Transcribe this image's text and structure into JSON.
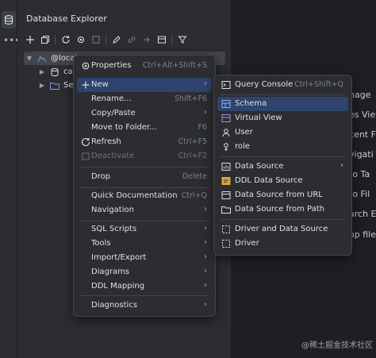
{
  "toolwindow": {
    "title": "Database Explorer"
  },
  "tree": {
    "root_label": "@local",
    "child1_label": "cat",
    "child2_label": "Ser"
  },
  "editor_behind": {
    "lines": [
      "nage",
      "es View",
      "cent F",
      "vigati",
      "to Ta",
      "to Fil",
      "arch E",
      "op file"
    ],
    "watermark": "@稀土掘金技术社区"
  },
  "context_menu": {
    "properties": {
      "label": "Properties",
      "shortcut": "Ctrl+Alt+Shift+S"
    },
    "new": {
      "label": "New"
    },
    "rename": {
      "label": "Rename...",
      "shortcut": "Shift+F6"
    },
    "copy_paste": {
      "label": "Copy/Paste"
    },
    "move_to_folder": {
      "label": "Move to Folder...",
      "shortcut": "F6"
    },
    "refresh": {
      "label": "Refresh",
      "shortcut": "Ctrl+F5"
    },
    "deactivate": {
      "label": "Deactivate",
      "shortcut": "Ctrl+F2"
    },
    "drop": {
      "label": "Drop",
      "shortcut": "Delete"
    },
    "quick_doc": {
      "label": "Quick Documentation",
      "shortcut": "Ctrl+Q"
    },
    "navigation": {
      "label": "Navigation"
    },
    "sql_scripts": {
      "label": "SQL Scripts"
    },
    "tools": {
      "label": "Tools"
    },
    "import_export": {
      "label": "Import/Export"
    },
    "diagrams": {
      "label": "Diagrams"
    },
    "ddl_mapping": {
      "label": "DDL Mapping"
    },
    "diagnostics": {
      "label": "Diagnostics"
    }
  },
  "new_submenu": {
    "query_console": {
      "label": "Query Console",
      "shortcut": "Ctrl+Shift+Q"
    },
    "schema": {
      "label": "Schema"
    },
    "virtual_view": {
      "label": "Virtual View"
    },
    "user": {
      "label": "User"
    },
    "role": {
      "label": "role"
    },
    "data_source": {
      "label": "Data Source"
    },
    "ddl_data_source": {
      "label": "DDL Data Source"
    },
    "data_source_from_url": {
      "label": "Data Source from URL"
    },
    "data_source_from_path": {
      "label": "Data Source from Path"
    },
    "driver_and_data_source": {
      "label": "Driver and Data Source"
    },
    "driver": {
      "label": "Driver"
    }
  },
  "colors": {
    "accent_selection": "#2e436e",
    "menu_bg": "#2b2d30",
    "editor_bg": "#1e1f22"
  }
}
